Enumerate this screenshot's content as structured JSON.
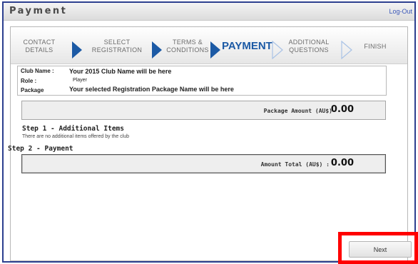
{
  "window": {
    "title": "Payment",
    "logout_label": "Log-Out"
  },
  "steps": [
    {
      "line1": "CONTACT",
      "line2": "DETAILS"
    },
    {
      "line1": "SELECT",
      "line2": "REGISTRATION"
    },
    {
      "line1": "TERMS &",
      "line2": "CONDITIONS"
    },
    {
      "line1": "PAYMENT",
      "line2": ""
    },
    {
      "line1": "ADDITIONAL",
      "line2": "QUESTIONS"
    },
    {
      "line1": "FINISH",
      "line2": ""
    }
  ],
  "active_step": "PAYMENT",
  "info": {
    "club_label": "Club Name :",
    "club_value": "Your 2015 Club Name will be here",
    "role_label": "Role :",
    "role_value": "Player",
    "package_label": "Package",
    "package_value": "Your selected Registration Package Name will be here"
  },
  "package_amount": {
    "label": "Package Amount (AU$)",
    "value": "0.00"
  },
  "step1": {
    "heading": "Step 1 - Additional Items",
    "note": "There are no additional items offered by the club"
  },
  "step2": {
    "heading": "Step 2 - Payment"
  },
  "amount_total": {
    "label": "Amount Total (AU$) :",
    "value": "0.00"
  },
  "buttons": {
    "next": "Next"
  },
  "colors": {
    "accent": "#1c5aa5",
    "frame": "#2c3f8f",
    "highlight": "#ff0000"
  }
}
